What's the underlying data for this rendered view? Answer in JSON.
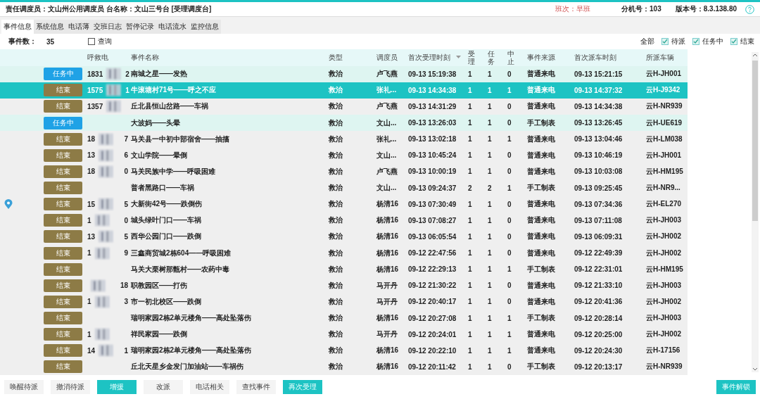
{
  "header": {
    "info": "责任调度员：文山州公用调度员 台名称：文山三号台 [受理调度台]",
    "shift": "班次：早班",
    "extension": "分机号：103",
    "version": "版本号：8.3.138.80"
  },
  "tabs": [
    {
      "label": "事件信息",
      "selected": true
    },
    {
      "label": "系统信息",
      "selected": false
    },
    {
      "label": "电话薄",
      "selected": false
    },
    {
      "label": "交班日志",
      "selected": false
    },
    {
      "label": "暂停记录",
      "selected": false
    },
    {
      "label": "电话流水",
      "selected": false
    },
    {
      "label": "监控信息",
      "selected": false
    }
  ],
  "summary": {
    "count_label": "事件数：",
    "count": "35",
    "query": {
      "label": "查询",
      "checked": false
    }
  },
  "filters": {
    "all": "全部",
    "options": [
      {
        "label": "待派",
        "checked": true
      },
      {
        "label": "任务中",
        "checked": true
      },
      {
        "label": "结束",
        "checked": true
      }
    ]
  },
  "columns": [
    {
      "label": "呼救电",
      "kind": "wide"
    },
    {
      "label": "事件名称",
      "kind": "wide"
    },
    {
      "label": "类型",
      "kind": "wide"
    },
    {
      "label": "调度员",
      "kind": "wide"
    },
    {
      "label": "首次受理时刻",
      "kind": "wide",
      "sorted": true
    },
    {
      "label": "受理",
      "kind": "narrow"
    },
    {
      "label": "任务",
      "kind": "narrow"
    },
    {
      "label": "中止",
      "kind": "narrow"
    },
    {
      "label": "事件来源",
      "kind": "wide"
    },
    {
      "label": "首次派车时刻",
      "kind": "wide"
    },
    {
      "label": "所派车辆",
      "kind": "wide"
    }
  ],
  "rows": [
    {
      "status": "任务中",
      "kind": "active",
      "selected": false,
      "caller_start": "1831",
      "caller_end": "2",
      "blurred": true,
      "name": "南城之星——发热",
      "type": "救治",
      "dispatcher": "卢飞燕",
      "accept": "09-13 15:19:38",
      "accepted": "1",
      "tasks": "1",
      "aborted": "0",
      "source": "普通来电",
      "dispatch": "09-13 15:21:15",
      "vehicle": "云H-JH001"
    },
    {
      "status": "结束",
      "kind": "ended",
      "selected": true,
      "caller_start": "1575",
      "caller_end": "1",
      "blurred": true,
      "name": "牛滚塘村71号——呼之不应",
      "type": "救治",
      "dispatcher": "张礼...",
      "accept": "09-13 14:34:38",
      "accepted": "1",
      "tasks": "1",
      "aborted": "1",
      "source": "普通来电",
      "dispatch": "09-13 14:37:32",
      "vehicle": "云H-J9342"
    },
    {
      "status": "结束",
      "kind": "ended",
      "selected": false,
      "caller_start": "1357",
      "blurred": true,
      "name": "丘北县恒山岔路——车祸",
      "type": "救治",
      "dispatcher": "卢飞燕",
      "accept": "09-13 14:31:29",
      "accepted": "1",
      "tasks": "1",
      "aborted": "0",
      "source": "普通来电",
      "dispatch": "09-13 14:34:38",
      "vehicle": "云H-NR939"
    },
    {
      "status": "任务中",
      "kind": "active",
      "selected": false,
      "blurred": false,
      "name": "大波妈——头晕",
      "type": "救治",
      "dispatcher": "文山...",
      "accept": "09-13 13:26:03",
      "accepted": "1",
      "tasks": "1",
      "aborted": "0",
      "source": "手工制表",
      "dispatch": "09-13 13:26:45",
      "vehicle": "云H-UE619"
    },
    {
      "status": "结束",
      "kind": "ended",
      "selected": false,
      "caller_start": "18",
      "caller_end": "7",
      "blurred": true,
      "name": "马关县一中初中部宿舍——抽搐",
      "type": "救治",
      "dispatcher": "张礼...",
      "accept": "09-13 13:02:18",
      "accepted": "1",
      "tasks": "1",
      "aborted": "1",
      "source": "普通来电",
      "dispatch": "09-13 13:04:46",
      "vehicle": "云H-LM038"
    },
    {
      "status": "结束",
      "kind": "ended",
      "selected": false,
      "caller_start": "13",
      "caller_end": "6",
      "blurred": true,
      "name": "文山学院——晕倒",
      "type": "救治",
      "dispatcher": "文山...",
      "accept": "09-13 10:45:24",
      "accepted": "1",
      "tasks": "1",
      "aborted": "0",
      "source": "普通来电",
      "dispatch": "09-13 10:46:19",
      "vehicle": "云H-JH001"
    },
    {
      "status": "结束",
      "kind": "ended",
      "selected": false,
      "caller_start": "18",
      "caller_end": "0",
      "blurred": true,
      "name": "马关民族中学——呼吸困难",
      "type": "救治",
      "dispatcher": "卢飞燕",
      "accept": "09-13 10:00:19",
      "accepted": "1",
      "tasks": "1",
      "aborted": "0",
      "source": "普通来电",
      "dispatch": "09-13 10:03:08",
      "vehicle": "云H-HM195"
    },
    {
      "status": "结束",
      "kind": "ended",
      "selected": false,
      "blurred": false,
      "name": "普者黑路口——车祸",
      "type": "救治",
      "dispatcher": "文山...",
      "accept": "09-13 09:24:37",
      "accepted": "2",
      "tasks": "2",
      "aborted": "1",
      "source": "手工制表",
      "dispatch": "09-13 09:25:45",
      "vehicle": "云H-NR9..."
    },
    {
      "status": "结束",
      "kind": "ended",
      "selected": false,
      "pinned": true,
      "caller_start": "15",
      "caller_end": "5",
      "blurred": true,
      "name": "大新街42号——跌倒伤",
      "type": "救治",
      "dispatcher": "杨清16",
      "accept": "09-13 07:30:49",
      "accepted": "1",
      "tasks": "1",
      "aborted": "0",
      "source": "普通来电",
      "dispatch": "09-13 07:34:36",
      "vehicle": "云H-EL270"
    },
    {
      "status": "结束",
      "kind": "ended",
      "selected": false,
      "caller_start": "1",
      "caller_end": "0",
      "blurred": true,
      "name": "城头绿叶门口——车祸",
      "type": "救治",
      "dispatcher": "杨清16",
      "accept": "09-13 07:08:27",
      "accepted": "1",
      "tasks": "1",
      "aborted": "0",
      "source": "普通来电",
      "dispatch": "09-13 07:11:08",
      "vehicle": "云H-JH003"
    },
    {
      "status": "结束",
      "kind": "ended",
      "selected": false,
      "caller_start": "13",
      "caller_end": "5",
      "blurred": true,
      "name": "西华公园门口——跌倒",
      "type": "救治",
      "dispatcher": "杨清16",
      "accept": "09-13 06:05:54",
      "accepted": "1",
      "tasks": "1",
      "aborted": "0",
      "source": "普通来电",
      "dispatch": "09-13 06:09:31",
      "vehicle": "云H-JH002"
    },
    {
      "status": "结束",
      "kind": "ended",
      "selected": false,
      "caller_start": "1",
      "caller_end": "9",
      "blurred": true,
      "name": "三鑫商贸城2栋604——呼吸困难",
      "type": "救治",
      "dispatcher": "杨清16",
      "accept": "09-12 22:47:56",
      "accepted": "1",
      "tasks": "1",
      "aborted": "0",
      "source": "普通来电",
      "dispatch": "09-12 22:49:39",
      "vehicle": "云H-JH002"
    },
    {
      "status": "结束",
      "kind": "ended",
      "selected": false,
      "blurred": false,
      "name": "马关大栗树那甑村——农药中毒",
      "type": "救治",
      "dispatcher": "杨清16",
      "accept": "09-12 22:29:13",
      "accepted": "1",
      "tasks": "1",
      "aborted": "1",
      "source": "手工制表",
      "dispatch": "09-12 22:31:01",
      "vehicle": "云H-HM195"
    },
    {
      "status": "结束",
      "kind": "ended",
      "selected": false,
      "caller_end": "18",
      "blurred": true,
      "name": "职教园区——打伤",
      "type": "救治",
      "dispatcher": "马开丹",
      "accept": "09-12 21:30:22",
      "accepted": "1",
      "tasks": "1",
      "aborted": "0",
      "source": "普通来电",
      "dispatch": "09-12 21:33:10",
      "vehicle": "云H-JH003"
    },
    {
      "status": "结束",
      "kind": "ended",
      "selected": false,
      "caller_start": "1",
      "caller_end": "3",
      "blurred": true,
      "name": "市一初北校区——跌倒",
      "type": "救治",
      "dispatcher": "马开丹",
      "accept": "09-12 20:40:17",
      "accepted": "1",
      "tasks": "1",
      "aborted": "0",
      "source": "普通来电",
      "dispatch": "09-12 20:41:36",
      "vehicle": "云H-JH002"
    },
    {
      "status": "结束",
      "kind": "ended",
      "selected": false,
      "blurred": false,
      "name": "瑞明家园2栋2单元楼角——高处坠落伤",
      "type": "救治",
      "dispatcher": "杨清16",
      "accept": "09-12 20:27:08",
      "accepted": "1",
      "tasks": "1",
      "aborted": "1",
      "source": "手工制表",
      "dispatch": "09-12 20:28:14",
      "vehicle": "云H-JH003"
    },
    {
      "status": "结束",
      "kind": "ended",
      "selected": false,
      "caller_start": "1",
      "blurred": true,
      "name": "祥民家园——跌倒",
      "type": "救治",
      "dispatcher": "马开丹",
      "accept": "09-12 20:24:01",
      "accepted": "1",
      "tasks": "1",
      "aborted": "1",
      "source": "普通来电",
      "dispatch": "09-12 20:25:00",
      "vehicle": "云H-JH002"
    },
    {
      "status": "结束",
      "kind": "ended",
      "selected": false,
      "caller_start": "14",
      "caller_end": "1",
      "blurred": true,
      "name": "瑞明家园2栋2单元楼角——高处坠落伤",
      "type": "救治",
      "dispatcher": "杨清16",
      "accept": "09-12 20:22:10",
      "accepted": "1",
      "tasks": "1",
      "aborted": "1",
      "source": "普通来电",
      "dispatch": "09-12 20:24:30",
      "vehicle": "云H-17156"
    },
    {
      "status": "结束",
      "kind": "ended",
      "selected": false,
      "blurred": false,
      "name": "丘北天星乡金发门加油站——车祸伤",
      "type": "救治",
      "dispatcher": "杨清16",
      "accept": "09-12 20:11:42",
      "accepted": "1",
      "tasks": "1",
      "aborted": "0",
      "source": "手工制表",
      "dispatch": "09-12 20:13:17",
      "vehicle": "云H-NR939"
    }
  ],
  "actions": [
    {
      "label": "唤醒待派",
      "highlighted": false
    },
    {
      "label": "撤消待派",
      "highlighted": false
    },
    {
      "label": "增援",
      "highlighted": true
    },
    {
      "label": "改派",
      "highlighted": false
    },
    {
      "label": "电话相关",
      "highlighted": false
    },
    {
      "label": "查找事件",
      "highlighted": false
    },
    {
      "label": "再次受理",
      "highlighted": true
    }
  ],
  "unlock": {
    "label": "事件解锁",
    "highlighted": true
  }
}
